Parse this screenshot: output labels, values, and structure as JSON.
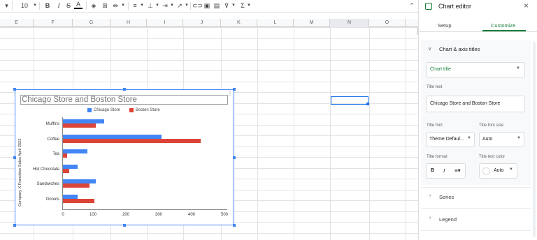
{
  "toolbar": {
    "font_size": "10",
    "bold": "B",
    "italic": "I",
    "strike": "S",
    "text_color": "A",
    "sigma": "Σ"
  },
  "columns": [
    "E",
    "F",
    "G",
    "H",
    "I",
    "J",
    "K",
    "L",
    "M",
    "N",
    "O"
  ],
  "chart": {
    "title": "Chicago Store and Boston Store",
    "y_axis_title": "Company X Franchise Sales April 2022",
    "legend": [
      "Chicago Store",
      "Boston Store"
    ],
    "x_ticks": [
      "0",
      "100",
      "200",
      "300",
      "400",
      "500"
    ],
    "more_icon": "⋮"
  },
  "chart_data": {
    "type": "bar",
    "orientation": "horizontal",
    "title": "Chicago Store and Boston Store",
    "ylabel": "Company X Franchise Sales April 2022",
    "xlabel": "",
    "categories": [
      "Muffins",
      "Coffee",
      "Tea",
      "Hot Chocolate",
      "Sandwiches",
      "Donuts"
    ],
    "series": [
      {
        "name": "Chicago Store",
        "color": "#4285f4",
        "values": [
          125,
          300,
          75,
          45,
          100,
          45
        ]
      },
      {
        "name": "Boston Store",
        "color": "#db4437",
        "values": [
          100,
          420,
          12,
          20,
          80,
          95
        ]
      }
    ],
    "xlim": [
      0,
      500
    ],
    "legend_position": "top",
    "grid": false
  },
  "sidebar": {
    "title": "Chart editor",
    "close": "×",
    "tab_setup": "Setup",
    "tab_customize": "Customize",
    "section_titles": "Chart & axis titles",
    "title_type": "Chart title",
    "title_text_label": "Title text",
    "title_text_value": "Chicago Store and Boston Store",
    "title_font_label": "Title font",
    "title_font_value": "Theme Defaul...",
    "title_font_size_label": "Title font size",
    "title_font_size_value": "Auto",
    "title_format_label": "Title format",
    "format_bold": "B",
    "format_italic": "I",
    "title_text_color_label": "Title text color",
    "title_text_color_value": "Auto",
    "section_series": "Series",
    "section_legend": "Legend",
    "accent": "#188038"
  }
}
